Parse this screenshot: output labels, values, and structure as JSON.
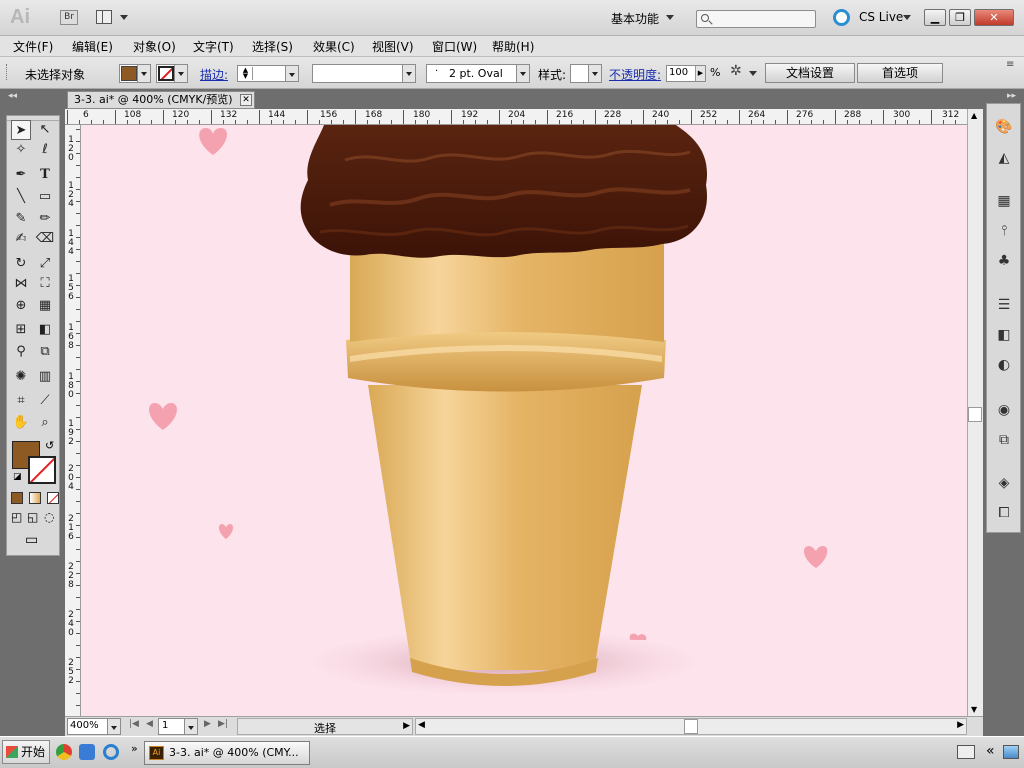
{
  "app": {
    "logo": "Ai",
    "bridge_label": "Br",
    "workspace_label": "基本功能",
    "cs_live_label": "CS Live",
    "window_buttons": {
      "minimize": "▁",
      "restore": "❐",
      "close": "✕"
    }
  },
  "menu": {
    "items": [
      "文件(F)",
      "编辑(E)",
      "对象(O)",
      "文字(T)",
      "选择(S)",
      "效果(C)",
      "视图(V)",
      "窗口(W)",
      "帮助(H)"
    ]
  },
  "control_bar": {
    "selection_label": "未选择对象",
    "fill_color": "#8c5a22",
    "stroke_label": "描边:",
    "brush_value": "2 pt. Oval",
    "style_label": "样式:",
    "opacity_label": "不透明度:",
    "opacity_value": "100",
    "percent": "%",
    "doc_setup_label": "文档设置",
    "prefs_label": "首选项"
  },
  "document": {
    "tab_title": "3-3. ai* @ 400% (CMYK/预览)",
    "tab_close": "✕",
    "ruler_h_labels": [
      "6",
      "108",
      "120",
      "132",
      "144",
      "156",
      "168",
      "180",
      "192",
      "204",
      "216",
      "228",
      "240",
      "252",
      "264",
      "276",
      "288",
      "300",
      "312"
    ],
    "ruler_v_labels": [
      "1\n2\n0",
      "1\n2\n4",
      "1\n4\n4",
      "1\n5\n6",
      "1\n6\n8",
      "1\n8\n0",
      "1\n9\n2",
      "2\n0\n4",
      "2\n1\n6",
      "2\n2\n8",
      "2\n4\n0",
      "2\n5\n2"
    ],
    "canvas_bg": "#fde3ec"
  },
  "status_bar": {
    "zoom": "400%",
    "page": "1",
    "status_label": "选择"
  },
  "taskbar": {
    "start_label": "开始",
    "task_label": "3-3. ai* @ 400% (CMY..."
  },
  "toolbox": {
    "fill_color": "#8c5a22",
    "tools": [
      "selection-tool",
      "direct-selection-tool",
      "magic-wand-tool",
      "lasso-tool",
      "pen-tool",
      "type-tool",
      "line-tool",
      "rectangle-tool",
      "paintbrush-tool",
      "pencil-tool",
      "blob-brush-tool",
      "eraser-tool",
      "rotate-tool",
      "scale-tool",
      "width-tool",
      "free-transform-tool",
      "shape-builder-tool",
      "perspective-grid-tool",
      "mesh-tool",
      "gradient-tool",
      "eyedropper-tool",
      "blend-tool",
      "symbol-sprayer-tool",
      "column-graph-tool",
      "artboard-tool",
      "slice-tool",
      "hand-tool",
      "zoom-tool"
    ]
  },
  "right_dock": {
    "icons": [
      "color-panel-icon",
      "color-guide-icon",
      "swatches-icon",
      "brushes-icon",
      "symbols-icon",
      "stroke-icon",
      "gradient-icon",
      "transparency-icon",
      "appearance-icon",
      "graphic-styles-icon",
      "layers-icon",
      "artboards-icon"
    ]
  }
}
